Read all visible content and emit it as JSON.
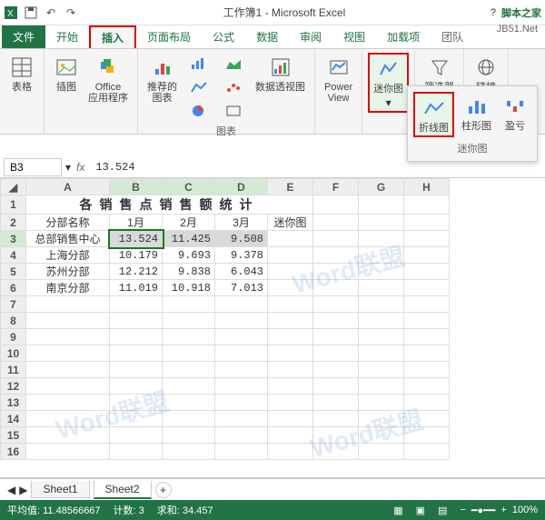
{
  "title": "工作簿1 - Microsoft Excel",
  "brand": {
    "logo": "脚本之家",
    "sub": "JB51.Net"
  },
  "tabs": {
    "file": "文件",
    "home": "开始",
    "insert": "插入",
    "layout": "页面布局",
    "formula": "公式",
    "data": "数据",
    "review": "审阅",
    "view": "视图",
    "addin": "加载项",
    "team": "团队"
  },
  "ribbon": {
    "table": "表格",
    "image": "插图",
    "office": "Office\n应用程序",
    "recchart": "推荐的\n图表",
    "charts": "图表",
    "pivot": "数据透视图",
    "power": "Power\nView",
    "spark": "迷你图",
    "filter": "筛选器",
    "link": "链接"
  },
  "sparkpop": {
    "line": "折线图",
    "column": "柱形图",
    "winloss": "盈亏",
    "group": "迷你图"
  },
  "namebox": "B3",
  "formula": "13.524",
  "fx": "fx",
  "cols": [
    "A",
    "B",
    "C",
    "D",
    "E",
    "F",
    "G",
    "H"
  ],
  "sheet": {
    "title": "各销售点销售额统计",
    "headers": {
      "name": "分部名称",
      "m1": "1月",
      "m2": "2月",
      "m3": "3月",
      "spark": "迷你图"
    },
    "rows": [
      {
        "name": "总部销售中心",
        "m1": "13.524",
        "m2": "11.425",
        "m3": "9.508"
      },
      {
        "name": "上海分部",
        "m1": "10.179",
        "m2": "9.693",
        "m3": "9.378"
      },
      {
        "name": "苏州分部",
        "m1": "12.212",
        "m2": "9.838",
        "m3": "6.043"
      },
      {
        "name": "南京分部",
        "m1": "11.019",
        "m2": "10.918",
        "m3": "7.013"
      }
    ]
  },
  "sheets": {
    "s1": "Sheet1",
    "s2": "Sheet2"
  },
  "status": {
    "avg_lbl": "平均值:",
    "avg": "11.48566667",
    "cnt_lbl": "计数:",
    "cnt": "3",
    "sum_lbl": "求和:",
    "sum": "34.457",
    "zoom": "100%"
  },
  "watermark": "Word联盟",
  "chart_data": {
    "type": "table",
    "title": "各销售点销售额统计",
    "columns": [
      "分部名称",
      "1月",
      "2月",
      "3月"
    ],
    "rows": [
      [
        "总部销售中心",
        13.524,
        11.425,
        9.508
      ],
      [
        "上海分部",
        10.179,
        9.693,
        9.378
      ],
      [
        "苏州分部",
        12.212,
        9.838,
        6.043
      ],
      [
        "南京分部",
        11.019,
        10.918,
        7.013
      ]
    ]
  }
}
